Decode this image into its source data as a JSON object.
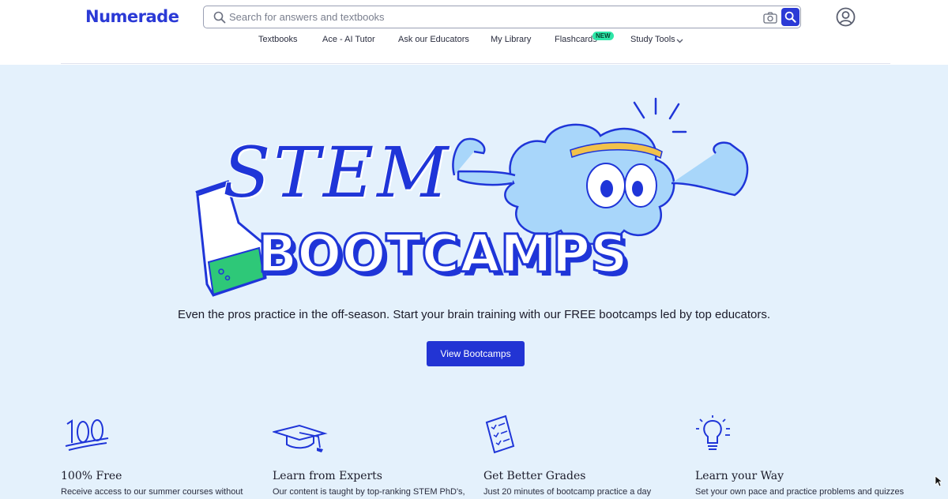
{
  "header": {
    "logo": "Numerade",
    "search_placeholder": "Search for answers and textbooks",
    "nav": [
      {
        "label": "Textbooks"
      },
      {
        "label": "Ace - AI Tutor"
      },
      {
        "label": "Ask our Educators"
      },
      {
        "label": "My Library"
      },
      {
        "label": "Flashcards",
        "badge": "NEW"
      },
      {
        "label": "Study Tools"
      }
    ]
  },
  "hero": {
    "title_line1": "STEM",
    "title_line2": "BOOTCAMPS",
    "subtitle": "Even the pros practice in the off-season. Start your brain training with our FREE bootcamps led by top educators.",
    "cta_label": "View Bootcamps"
  },
  "features": [
    {
      "icon": "hundred-icon",
      "title": "100% Free",
      "desc": "Receive access to our summer courses without"
    },
    {
      "icon": "graduation-cap-icon",
      "title": "Learn from Experts",
      "desc": "Our content is taught by top-ranking STEM PhD's,"
    },
    {
      "icon": "checklist-icon",
      "title": "Get Better Grades",
      "desc": "Just 20 minutes of bootcamp practice a day"
    },
    {
      "icon": "lightbulb-icon",
      "title": "Learn your Way",
      "desc": "Set your own pace and practice problems and quizzes"
    }
  ],
  "colors": {
    "brand": "#2b3ad6",
    "hero_bg": "#e4f1fc",
    "badge": "#2ee6a8"
  }
}
